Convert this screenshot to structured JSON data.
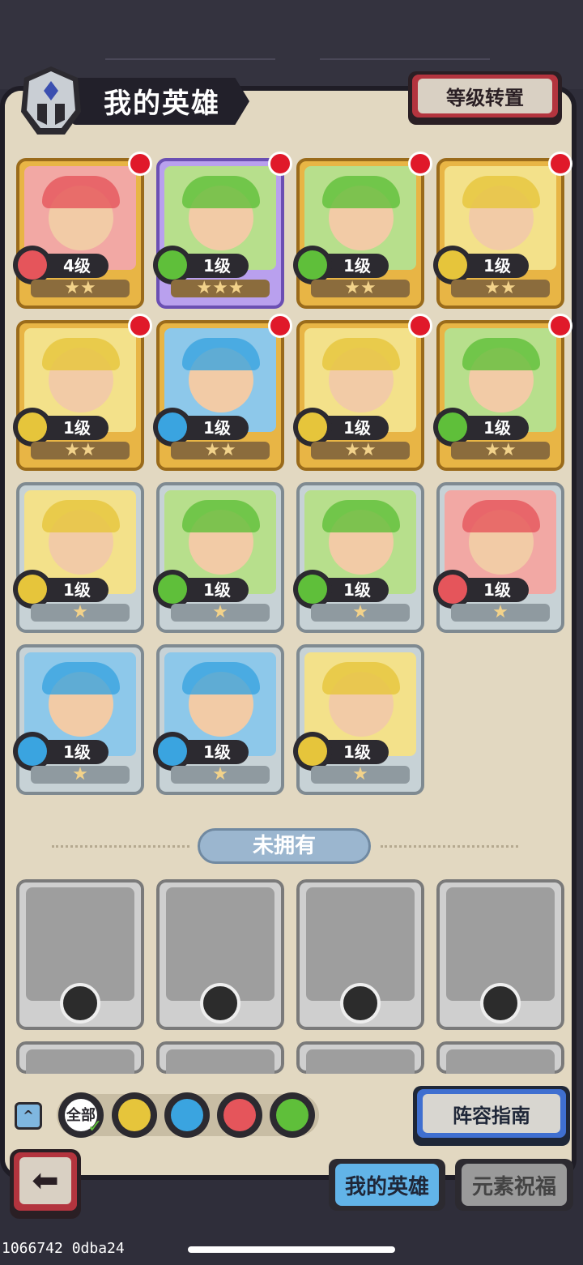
{
  "header": {
    "title": "我的英雄",
    "transfer_button": "等级转置"
  },
  "owned_heroes": [
    {
      "level": "4级",
      "element": "fire",
      "stars": "★★",
      "rarity": "gold",
      "badge": true
    },
    {
      "level": "1级",
      "element": "wind",
      "stars": "★★★",
      "rarity": "purple",
      "badge": true
    },
    {
      "level": "1级",
      "element": "wind",
      "stars": "★★",
      "rarity": "gold",
      "badge": true
    },
    {
      "level": "1级",
      "element": "earth",
      "stars": "★★",
      "rarity": "gold",
      "badge": true
    },
    {
      "level": "1级",
      "element": "earth",
      "stars": "★★",
      "rarity": "gold",
      "badge": true
    },
    {
      "level": "1级",
      "element": "water",
      "stars": "★★",
      "rarity": "gold",
      "badge": true
    },
    {
      "level": "1级",
      "element": "earth",
      "stars": "★★",
      "rarity": "gold",
      "badge": true
    },
    {
      "level": "1级",
      "element": "wind",
      "stars": "★★",
      "rarity": "gold",
      "badge": true
    },
    {
      "level": "1级",
      "element": "earth",
      "stars": "★",
      "rarity": "silver",
      "badge": false
    },
    {
      "level": "1级",
      "element": "wind",
      "stars": "★",
      "rarity": "silver",
      "badge": false
    },
    {
      "level": "1级",
      "element": "wind",
      "stars": "★",
      "rarity": "silver",
      "badge": false
    },
    {
      "level": "1级",
      "element": "fire",
      "stars": "★",
      "rarity": "silver",
      "badge": false
    },
    {
      "level": "1级",
      "element": "water",
      "stars": "★",
      "rarity": "silver",
      "badge": false
    },
    {
      "level": "1级",
      "element": "water",
      "stars": "★",
      "rarity": "silver",
      "badge": false
    },
    {
      "level": "1级",
      "element": "earth",
      "stars": "★",
      "rarity": "silver",
      "badge": false
    }
  ],
  "not_owned_label": "未拥有",
  "filters": {
    "all_label": "全部",
    "elements": [
      "earth",
      "water",
      "fire",
      "wind"
    ]
  },
  "lineup_button": "阵容指南",
  "tabs": {
    "my_heroes": "我的英雄",
    "element_blessing": "元素祝福"
  },
  "build_info": "1066742 0dba24",
  "colors": {
    "fire": "#e5555b",
    "water": "#3aa4e0",
    "wind": "#5fbf3a",
    "earth": "#e6c53b",
    "badge": "#e0192a"
  }
}
